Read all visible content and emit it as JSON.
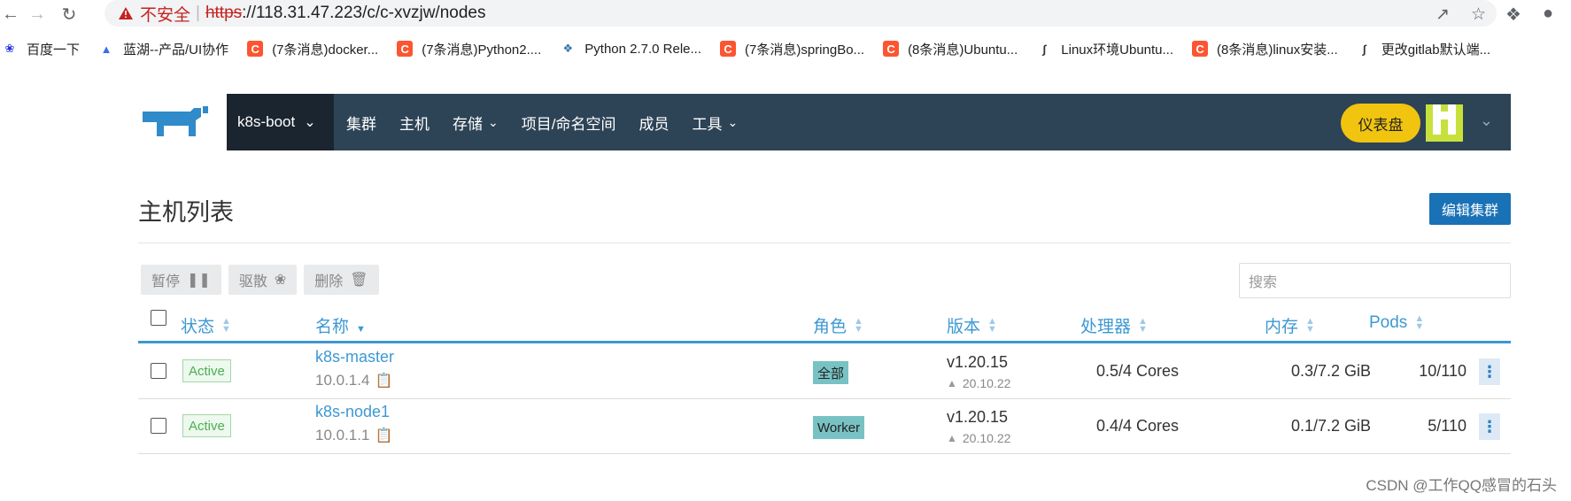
{
  "browser": {
    "security_label": "不安全",
    "url_scheme": "https",
    "url_rest": "://118.31.47.223/c/c-xvzjw/nodes"
  },
  "bookmarks": [
    {
      "label": "百度一下",
      "icon": "baidu-icon"
    },
    {
      "label": "蓝湖--产品/UI协作",
      "icon": "lanhu-icon"
    },
    {
      "label": "(7条消息)docker...",
      "icon": "csdn-icon"
    },
    {
      "label": "(7条消息)Python2....",
      "icon": "csdn-icon"
    },
    {
      "label": "Python 2.7.0 Rele...",
      "icon": "python-icon"
    },
    {
      "label": "(7条消息)springBo...",
      "icon": "csdn-icon"
    },
    {
      "label": "(8条消息)Ubuntu...",
      "icon": "csdn-icon"
    },
    {
      "label": "Linux环境Ubuntu...",
      "icon": "linux-icon"
    },
    {
      "label": "(8条消息)linux安装...",
      "icon": "csdn-icon"
    },
    {
      "label": "更改gitlab默认端...",
      "icon": "linux-icon"
    }
  ],
  "topnav": {
    "cluster": "k8s-boot",
    "items": [
      {
        "label": "集群",
        "dropdown": false
      },
      {
        "label": "主机",
        "dropdown": false
      },
      {
        "label": "存储",
        "dropdown": true
      },
      {
        "label": "项目/命名空间",
        "dropdown": false
      },
      {
        "label": "成员",
        "dropdown": false
      },
      {
        "label": "工具",
        "dropdown": true
      }
    ],
    "dashboard": "仪表盘"
  },
  "page": {
    "title": "主机列表",
    "edit_button": "编辑集群"
  },
  "bulk_actions": {
    "pause": "暂停",
    "drain": "驱散",
    "delete": "删除"
  },
  "search": {
    "placeholder": "搜索"
  },
  "table": {
    "headers": {
      "state": "状态",
      "name": "名称",
      "role": "角色",
      "version": "版本",
      "cpu": "处理器",
      "memory": "内存",
      "pods": "Pods"
    },
    "rows": [
      {
        "state": "Active",
        "name": "k8s-master",
        "ip": "10.0.1.4",
        "role": "全部",
        "version": "v1.20.15",
        "docker": "20.10.22",
        "cpu": "0.5/4 Cores",
        "memory": "0.3/7.2 GiB",
        "pods": "10/110"
      },
      {
        "state": "Active",
        "name": "k8s-node1",
        "ip": "10.0.1.1",
        "role": "Worker",
        "version": "v1.20.15",
        "docker": "20.10.22",
        "cpu": "0.4/4 Cores",
        "memory": "0.1/7.2 GiB",
        "pods": "5/110"
      }
    ]
  },
  "watermark": "CSDN @工作QQ感冒的石头",
  "colors": {
    "nav_bg": "#2d4356",
    "accent_blue": "#3d98d3",
    "dashboard_yellow": "#f1c40f",
    "primary_button": "#1a72b6",
    "active_green": "#4caf50",
    "role_teal": "#78c2c4"
  }
}
